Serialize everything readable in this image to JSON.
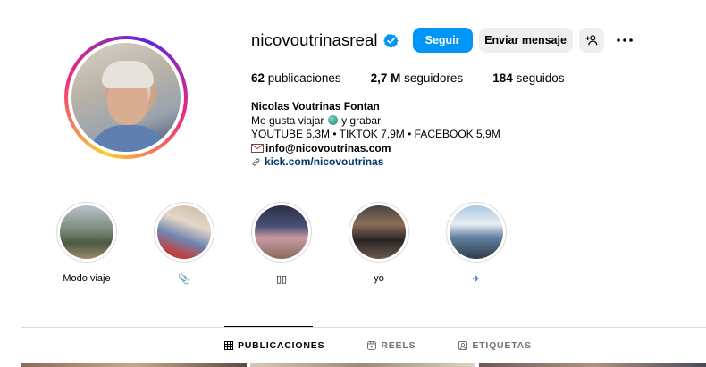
{
  "profile": {
    "username": "nicovoutrinasreal",
    "verified": true,
    "follow_label": "Seguir",
    "message_label": "Enviar mensaje",
    "accent_color": "#0095f6"
  },
  "stats": {
    "posts_count": "62",
    "posts_label": "publicaciones",
    "followers_count": "2,7 M",
    "followers_label": "seguidores",
    "following_count": "184",
    "following_label": "seguidos"
  },
  "bio": {
    "name": "Nicolas Voutrinas Fontan",
    "line1_before": "Me gusta viajar",
    "line1_after": "y grabar",
    "line2": "YOUTUBE 5,3M • TIKTOK 7,9M • FACEBOOK 5,9M",
    "email": "info@nicovoutrinas.com",
    "link": "kick.com/nicovoutrinas"
  },
  "stories": [
    {
      "label": "Modo viaje"
    },
    {
      "label": "📎"
    },
    {
      "label": "▯▯"
    },
    {
      "label": "yo"
    },
    {
      "label": "✈"
    }
  ],
  "tabs": [
    {
      "label": "PUBLICACIONES",
      "active": true,
      "icon": "grid-icon"
    },
    {
      "label": "REELS",
      "active": false,
      "icon": "reels-icon"
    },
    {
      "label": "ETIQUETAS",
      "active": false,
      "icon": "tagged-icon"
    }
  ]
}
